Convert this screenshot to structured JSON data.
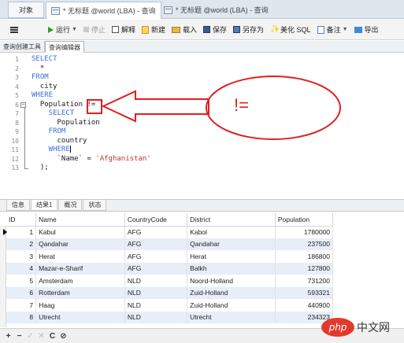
{
  "window_tabs": [
    {
      "label": "对象"
    },
    {
      "label": "* 无标题 @world (LBA) - 查询"
    },
    {
      "label": "* 无标题 @world (LBA) - 查询"
    }
  ],
  "toolbar": {
    "run": "运行",
    "stop": "停止",
    "explain": "解释",
    "new": "新建",
    "load": "载入",
    "save": "保存",
    "save_as": "另存为",
    "beautify": "美化 SQL",
    "notes": "备注",
    "export": "导出"
  },
  "sub_tabs": [
    "查询创建工具",
    "查询编辑器"
  ],
  "editor": {
    "line_numbers": [
      "1",
      "2",
      "3",
      "4",
      "5",
      "6",
      "7",
      "8",
      "9",
      "10",
      "11",
      "12",
      "13"
    ],
    "lines": [
      [
        {
          "t": "SELECT",
          "k": "kw"
        }
      ],
      [
        {
          "t": "  *",
          "k": "tx"
        }
      ],
      [
        {
          "t": "FROM",
          "k": "kw"
        }
      ],
      [
        {
          "t": "  city",
          "k": "tx"
        }
      ],
      [
        {
          "t": "WHERE",
          "k": "kw"
        }
      ],
      [
        {
          "t": "  Population ",
          "k": "tx"
        },
        {
          "t": "!=",
          "k": "tx"
        },
        {
          "t": " (",
          "k": "tx"
        }
      ],
      [
        {
          "t": "    SELECT",
          "k": "kw"
        }
      ],
      [
        {
          "t": "      Population",
          "k": "tx"
        }
      ],
      [
        {
          "t": "    FROM",
          "k": "kw"
        }
      ],
      [
        {
          "t": "      country",
          "k": "tx"
        }
      ],
      [
        {
          "t": "    WHERE",
          "k": "kw"
        }
      ],
      [
        {
          "t": "      `Name` = ",
          "k": "tx"
        },
        {
          "t": "'Afghanistan'",
          "k": "st"
        }
      ],
      [
        {
          "t": "  );",
          "k": "tx"
        }
      ]
    ]
  },
  "annotation": {
    "label": "!=",
    "color": "#e02020"
  },
  "result_tabs": [
    "信息",
    "结果1",
    "概况",
    "状态"
  ],
  "grid": {
    "columns": [
      "ID",
      "Name",
      "CountryCode",
      "District",
      "Population"
    ],
    "rows": [
      [
        "1",
        "Kabul",
        "AFG",
        "Kabol",
        "1780000"
      ],
      [
        "2",
        "Qandahar",
        "AFG",
        "Qandahar",
        "237500"
      ],
      [
        "3",
        "Herat",
        "AFG",
        "Herat",
        "186800"
      ],
      [
        "4",
        "Mazar-e-Sharif",
        "AFG",
        "Balkh",
        "127800"
      ],
      [
        "5",
        "Amsterdam",
        "NLD",
        "Noord-Holland",
        "731200"
      ],
      [
        "6",
        "Rotterdam",
        "NLD",
        "Zuid-Holland",
        "593321"
      ],
      [
        "7",
        "Haag",
        "NLD",
        "Zuid-Holland",
        "440900"
      ],
      [
        "8",
        "Utrecht",
        "NLD",
        "Utrecht",
        "234323"
      ]
    ]
  },
  "bottom_buttons": [
    "+",
    "−",
    "✓",
    "✕",
    "C",
    "⊘"
  ],
  "watermark": {
    "logo": "php",
    "text": "中文网"
  }
}
